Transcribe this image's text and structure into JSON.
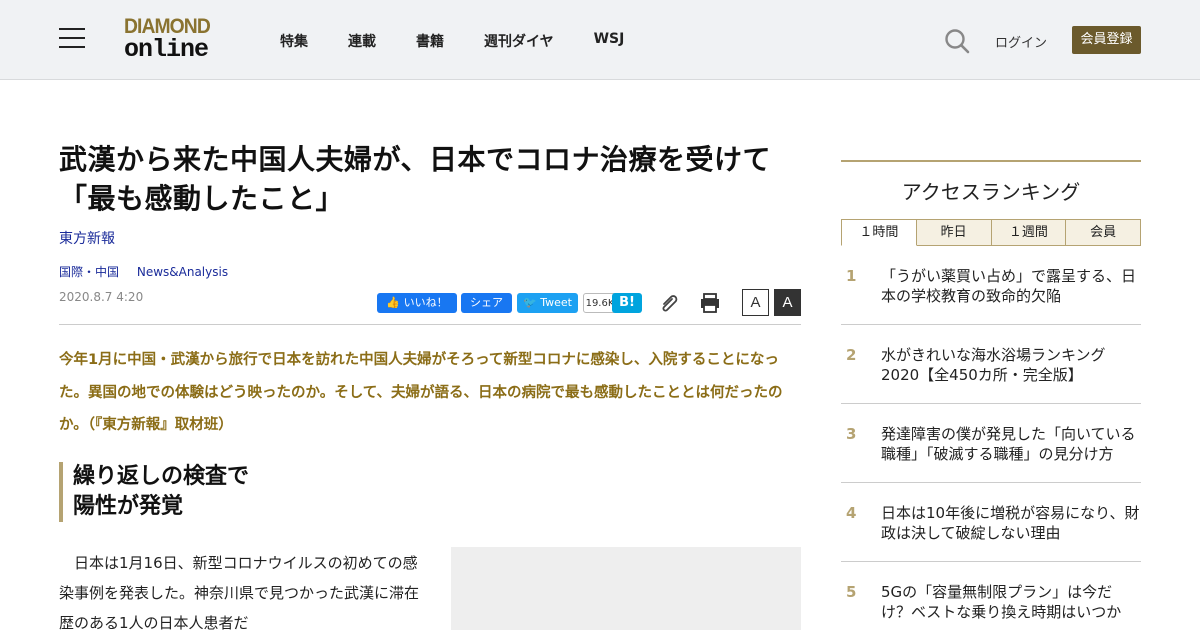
{
  "header": {
    "logo_top": "DIAMOND",
    "logo_bottom": "online",
    "nav": [
      "特集",
      "連載",
      "書籍",
      "週刊ダイヤ",
      "WSJ"
    ],
    "login": "ログイン",
    "register": "会員登録"
  },
  "article": {
    "title": "武漢から来た中国人夫婦が、日本でコロナ治療を受けて「最も感動したこと」",
    "source": "東方新報",
    "categories": [
      "国際・中国",
      "News&Analysis"
    ],
    "date": "2020.8.7 4:20",
    "share": {
      "fb_like": "いいね！",
      "fb_share": "シェア",
      "tweet": "Tweet",
      "hatena_count": "19.6K",
      "hatena": "B!"
    },
    "font_small": "A",
    "font_large": "A",
    "lead": "今年1月に中国・武漢から旅行で日本を訪れた中国人夫婦がそろって新型コロナに感染し、入院することになった。異国の地での体験はどう映ったのか。そして、夫婦が語る、日本の病院で最も感動したこととは何だったのか。（『東方新報』取材班）",
    "section_line1": "繰り返しの検査で",
    "section_line2": "陽性が発覚",
    "body": "日本は1月16日、新型コロナウイルスの初めての感染事例を発表した。神奈川県で見つかった武漢に滞在歴のある1人の日本人患者だ"
  },
  "ranking": {
    "title": "アクセスランキング",
    "tabs": [
      "１時間",
      "昨日",
      "１週間",
      "会員"
    ],
    "items": [
      {
        "num": "1",
        "text": "「うがい薬買い占め」で露呈する、日本の学校教育の致命的欠陥"
      },
      {
        "num": "2",
        "text": "水がきれいな海水浴場ランキング2020【全450カ所・完全版】"
      },
      {
        "num": "3",
        "text": "発達障害の僕が発見した「向いている職種」「破滅する職種」の見分け方"
      },
      {
        "num": "4",
        "text": "日本は10年後に増税が容易になり、財政は決して破綻しない理由"
      },
      {
        "num": "5",
        "text": "5Gの「容量無制限プラン」は今だけ？ベストな乗り換え時期はいつか"
      }
    ]
  }
}
